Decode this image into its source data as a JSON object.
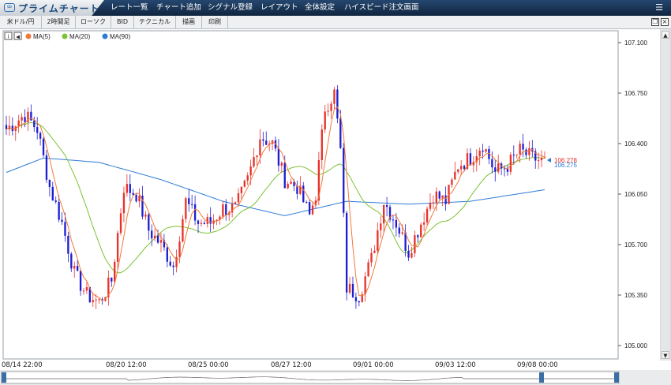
{
  "app": {
    "title": "プライムチャート",
    "menu_icon": "hamburger-icon"
  },
  "menu": [
    "レート一覧",
    "チャート追加",
    "シグナル登録",
    "レイアウト",
    "全体設定",
    "ハイスピード注文画面"
  ],
  "toolbar": [
    "米ドル/円",
    "2時間足",
    "ローソク",
    "BID",
    "テクニカル",
    "描画",
    "印刷"
  ],
  "legend": {
    "info_icon": "i",
    "collapse_icon": "◀",
    "items": [
      {
        "label": "MA(5)",
        "color": "#f07a3a"
      },
      {
        "label": "MA(20)",
        "color": "#7cc233"
      },
      {
        "label": "MA(90)",
        "color": "#2e7bd6"
      }
    ]
  },
  "price_tags": {
    "ask": "106.278",
    "bid": "106.275"
  },
  "colors": {
    "up": "#e8322b",
    "down": "#1f1fd1",
    "ma5": "#f07a3a",
    "ma20": "#7cc233",
    "ma90": "#2e7bd6"
  },
  "chart_data": {
    "type": "candlestick",
    "symbol": "米ドル/円",
    "timeframe": "2時間足",
    "x_labels": [
      "08/14 22:00",
      "08/20 12:00",
      "08/25 00:00",
      "08/27 12:00",
      "09/01 00:00",
      "09/03 12:00",
      "09/08 00:00"
    ],
    "y_ticks": [
      "107.100",
      "106.750",
      "106.400",
      "106.050",
      "105.700",
      "105.350",
      "105.000"
    ],
    "ylim": [
      105.0,
      107.1
    ],
    "grid": false,
    "close_anchors": [
      {
        "i": 0,
        "v": 106.5
      },
      {
        "i": 6,
        "v": 106.6
      },
      {
        "i": 10,
        "v": 106.5
      },
      {
        "i": 14,
        "v": 106.1
      },
      {
        "i": 18,
        "v": 105.85
      },
      {
        "i": 22,
        "v": 105.5
      },
      {
        "i": 26,
        "v": 105.35
      },
      {
        "i": 30,
        "v": 105.3
      },
      {
        "i": 34,
        "v": 105.45
      },
      {
        "i": 38,
        "v": 106.1
      },
      {
        "i": 42,
        "v": 106.05
      },
      {
        "i": 46,
        "v": 105.8
      },
      {
        "i": 50,
        "v": 105.7
      },
      {
        "i": 54,
        "v": 105.55
      },
      {
        "i": 58,
        "v": 106.0
      },
      {
        "i": 62,
        "v": 105.85
      },
      {
        "i": 66,
        "v": 105.85
      },
      {
        "i": 70,
        "v": 105.95
      },
      {
        "i": 74,
        "v": 105.95
      },
      {
        "i": 78,
        "v": 106.15
      },
      {
        "i": 82,
        "v": 106.45
      },
      {
        "i": 86,
        "v": 106.4
      },
      {
        "i": 90,
        "v": 106.15
      },
      {
        "i": 94,
        "v": 106.1
      },
      {
        "i": 98,
        "v": 105.9
      },
      {
        "i": 100,
        "v": 106.05
      },
      {
        "i": 103,
        "v": 106.65
      },
      {
        "i": 106,
        "v": 106.75
      },
      {
        "i": 108,
        "v": 106.35
      },
      {
        "i": 110,
        "v": 105.4
      },
      {
        "i": 114,
        "v": 105.35
      },
      {
        "i": 118,
        "v": 105.6
      },
      {
        "i": 122,
        "v": 106.0
      },
      {
        "i": 126,
        "v": 105.85
      },
      {
        "i": 130,
        "v": 105.65
      },
      {
        "i": 134,
        "v": 105.85
      },
      {
        "i": 138,
        "v": 106.05
      },
      {
        "i": 142,
        "v": 106.0
      },
      {
        "i": 146,
        "v": 106.25
      },
      {
        "i": 150,
        "v": 106.3
      },
      {
        "i": 154,
        "v": 106.4
      },
      {
        "i": 158,
        "v": 106.2
      },
      {
        "i": 162,
        "v": 106.25
      },
      {
        "i": 166,
        "v": 106.35
      },
      {
        "i": 170,
        "v": 106.3
      },
      {
        "i": 174,
        "v": 106.27
      }
    ],
    "ma90_anchors": [
      {
        "i": 0,
        "v": 106.2
      },
      {
        "i": 12,
        "v": 106.3
      },
      {
        "i": 30,
        "v": 106.27
      },
      {
        "i": 50,
        "v": 106.15
      },
      {
        "i": 70,
        "v": 106.0
      },
      {
        "i": 90,
        "v": 105.9
      },
      {
        "i": 100,
        "v": 105.95
      },
      {
        "i": 110,
        "v": 106.0
      },
      {
        "i": 130,
        "v": 105.98
      },
      {
        "i": 150,
        "v": 106.0
      },
      {
        "i": 174,
        "v": 106.08
      }
    ],
    "series": [
      {
        "name": "MA(5)",
        "period": 5
      },
      {
        "name": "MA(20)",
        "period": 20
      },
      {
        "name": "MA(90)",
        "period": 90
      }
    ],
    "last": {
      "ask": 106.278,
      "bid": 106.275
    }
  }
}
